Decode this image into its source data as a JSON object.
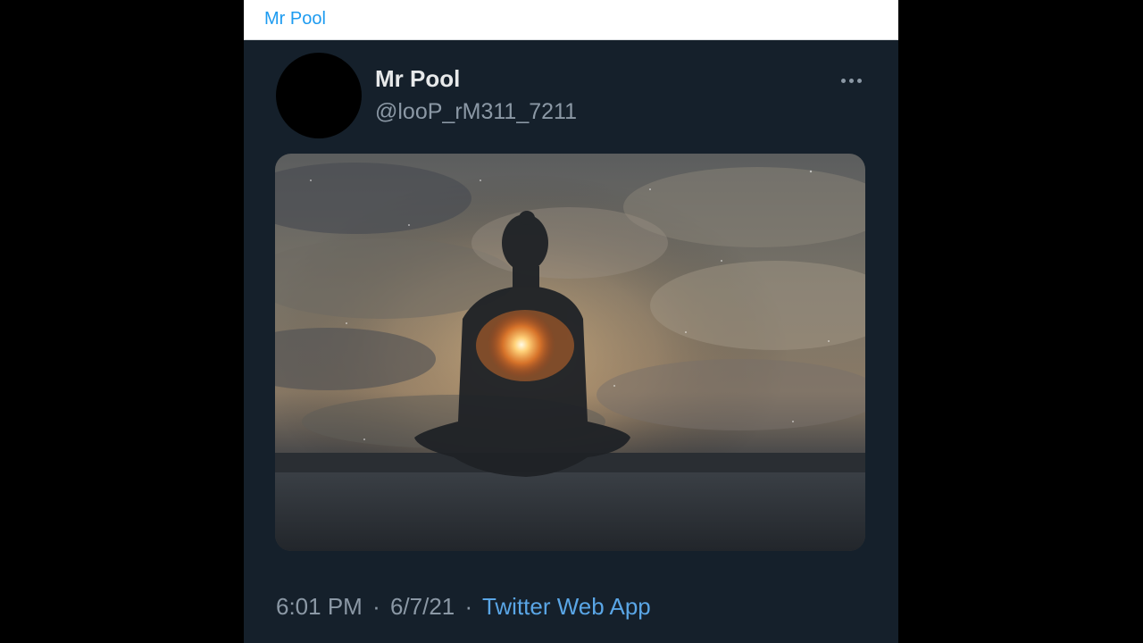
{
  "topbar": {
    "title": "Mr Pool"
  },
  "tweet": {
    "display_name": "Mr Pool",
    "handle": "@looP_rM311_7211",
    "more_icon": "more-horizontal-icon",
    "media": {
      "description_icon": "meditation-photo"
    },
    "time": "6:01 PM",
    "date": "6/7/21",
    "separator": "·",
    "source": "Twitter Web App"
  },
  "colors": {
    "background": "#15202b",
    "link": "#1d9bf0",
    "muted": "#8b98a5",
    "text": "#e7e9ea"
  }
}
